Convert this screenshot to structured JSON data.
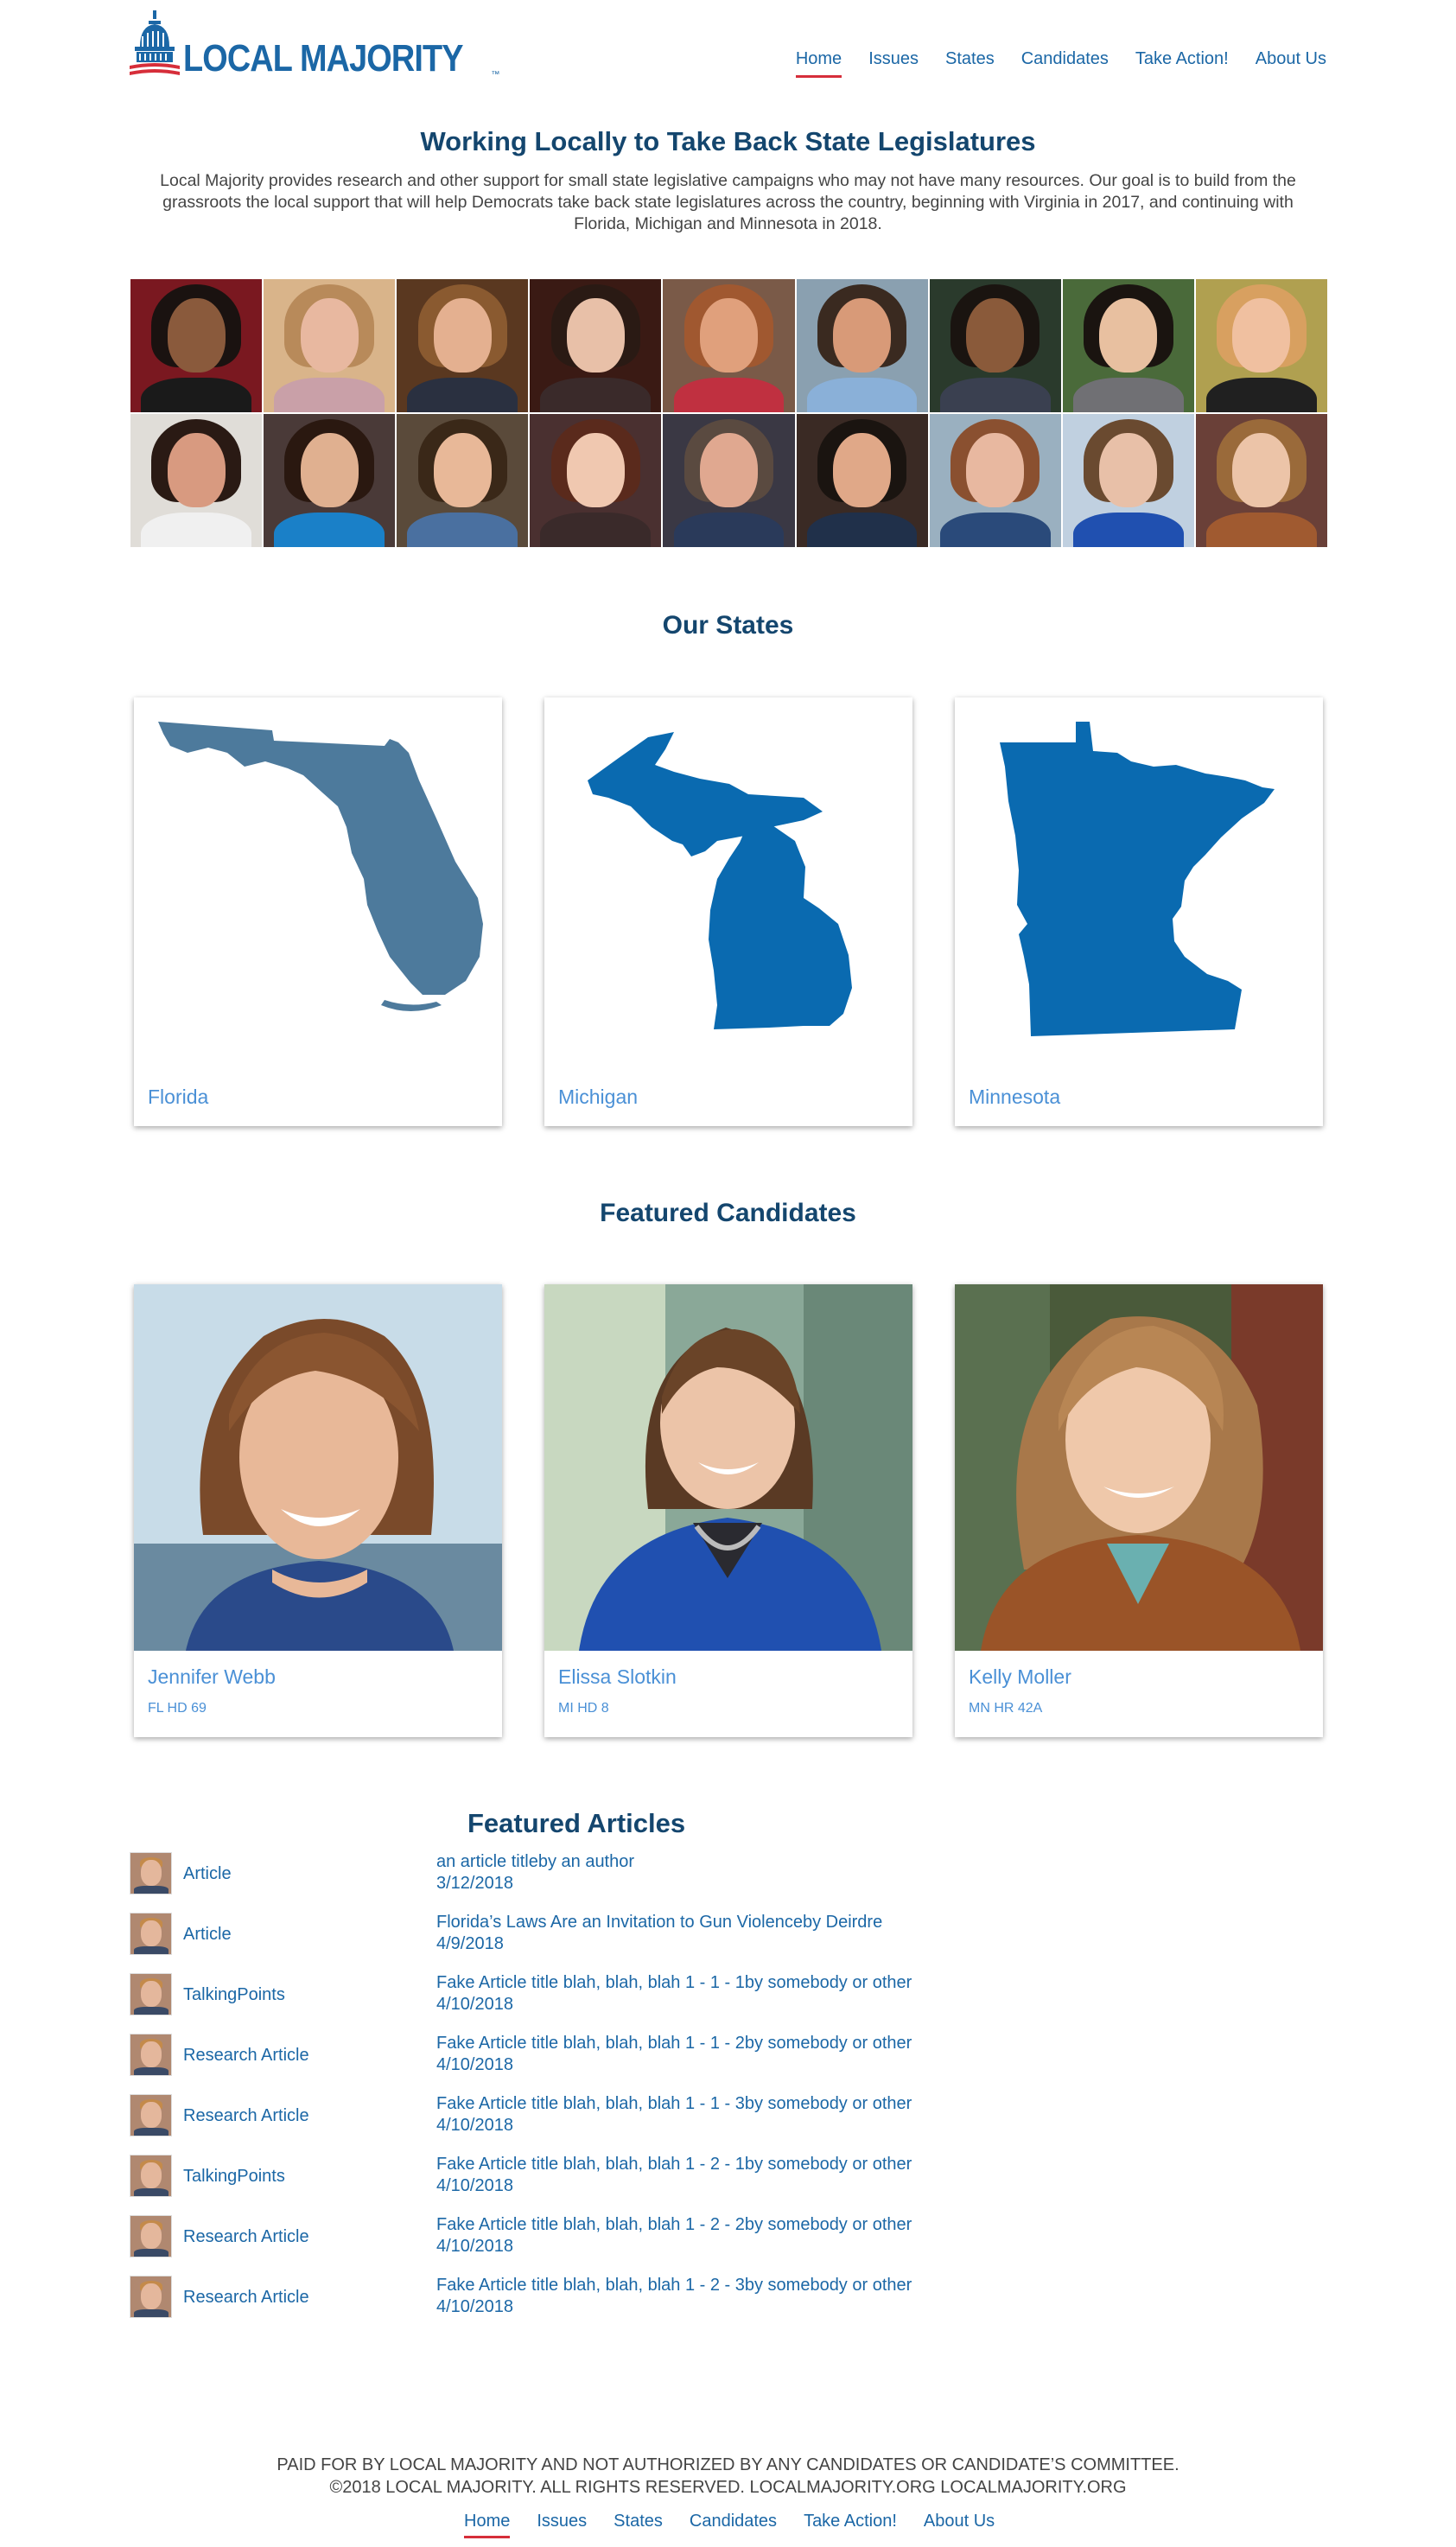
{
  "brand": {
    "name": "LOCAL MAJORITY",
    "tm": "™",
    "colors": {
      "primary": "#1b67a6",
      "heading": "#14466e",
      "accent": "#d62e3a",
      "link_light": "#4a90d6"
    }
  },
  "nav": {
    "items": [
      "Home",
      "Issues",
      "States",
      "Candidates",
      "Take Action!",
      "About Us"
    ],
    "active": "Home"
  },
  "intro": {
    "title": "Working Locally to Take Back State Legislatures",
    "text": "Local Majority provides research and other support for small state legislative campaigns who may not have many resources. Our goal is to build from the grassroots the local support that will help Democrats take back state legislatures across the country, beginning with Virginia in 2017, and continuing with Florida, Michigan and Minnesota in 2018."
  },
  "states_section": {
    "title": "Our States",
    "states": [
      {
        "name": "Florida",
        "color": "#4d7a9c"
      },
      {
        "name": "Michigan",
        "color": "#0a6ab0"
      },
      {
        "name": "Minnesota",
        "color": "#0a6ab0"
      }
    ]
  },
  "candidates_section": {
    "title": "Featured Candidates",
    "candidates": [
      {
        "name": "Jennifer Webb",
        "district": "FL HD 69"
      },
      {
        "name": "Elissa Slotkin",
        "district": "MI HD 8"
      },
      {
        "name": "Kelly Moller",
        "district": "MN HR 42A"
      }
    ]
  },
  "articles_section": {
    "title": "Featured Articles",
    "articles": [
      {
        "type": "Article",
        "title": "an article titleby an author",
        "date": "3/12/2018"
      },
      {
        "type": "Article",
        "title": "Florida’s Laws Are an Invitation to Gun Violenceby Deirdre",
        "date": "4/9/2018"
      },
      {
        "type": "TalkingPoints",
        "title": "Fake Article title blah, blah, blah 1 - 1 - 1by somebody or other",
        "date": "4/10/2018"
      },
      {
        "type": "Research Article",
        "title": "Fake Article title blah, blah, blah 1 - 1 - 2by somebody or other",
        "date": "4/10/2018"
      },
      {
        "type": "Research Article",
        "title": "Fake Article title blah, blah, blah 1 - 1 - 3by somebody or other",
        "date": "4/10/2018"
      },
      {
        "type": "TalkingPoints",
        "title": "Fake Article title blah, blah, blah 1 - 2 - 1by somebody or other",
        "date": "4/10/2018"
      },
      {
        "type": "Research Article",
        "title": "Fake Article title blah, blah, blah 1 - 2 - 2by somebody or other",
        "date": "4/10/2018"
      },
      {
        "type": "Research Article",
        "title": "Fake Article title blah, blah, blah 1 - 2 - 3by somebody or other",
        "date": "4/10/2018"
      }
    ]
  },
  "footer": {
    "line1": "PAID FOR BY LOCAL MAJORITY AND NOT AUTHORIZED BY ANY CANDIDATES OR CANDIDATE’S COMMITTEE.",
    "line2": "©2018 LOCAL MAJORITY. ALL RIGHTS RESERVED. LOCALMAJORITY.ORG LOCALMAJORITY.ORG",
    "nav": [
      "Home",
      "Issues",
      "States",
      "Candidates",
      "Take Action!",
      "About Us"
    ]
  },
  "photo_grid": {
    "tiles": [
      {
        "bg": "#7a1820",
        "skin": "#8a5a3c",
        "hair": "#1a1210",
        "shirt": "#1a1a1a"
      },
      {
        "bg": "#d9b48a",
        "skin": "#e8b8a0",
        "hair": "#b88a5a",
        "shirt": "#c9a0a8"
      },
      {
        "bg": "#5a3820",
        "skin": "#e4b090",
        "hair": "#8a5a30",
        "shirt": "#2a3040"
      },
      {
        "bg": "#3a1a14",
        "skin": "#e8c0a8",
        "hair": "#2a1a14",
        "shirt": "#3a2a2a"
      },
      {
        "bg": "#7a5a48",
        "skin": "#e0a07c",
        "hair": "#a05830",
        "shirt": "#c03040"
      },
      {
        "bg": "#8aa0b0",
        "skin": "#d89a78",
        "hair": "#3a2a20",
        "shirt": "#8ab0d8"
      },
      {
        "bg": "#2a3a2c",
        "skin": "#8a5a3a",
        "hair": "#1a1410",
        "shirt": "#3a4050"
      },
      {
        "bg": "#4a6a3a",
        "skin": "#e8c0a0",
        "hair": "#1a1410",
        "shirt": "#707074"
      },
      {
        "bg": "#b0a050",
        "skin": "#f0c0a0",
        "hair": "#d8a060",
        "shirt": "#202020"
      },
      {
        "bg": "#e0ddd8",
        "skin": "#d89a80",
        "hair": "#2a1a14",
        "shirt": "#f0f0f0"
      },
      {
        "bg": "#4a3a38",
        "skin": "#e0b090",
        "hair": "#2a1810",
        "shirt": "#1a80c8"
      },
      {
        "bg": "#5a4a3a",
        "skin": "#e8b898",
        "hair": "#3a2818",
        "shirt": "#4a70a0"
      },
      {
        "bg": "#4a3030",
        "skin": "#f0c8b0",
        "hair": "#5a2a1c",
        "shirt": "#3a2a2a"
      },
      {
        "bg": "#3a3844",
        "skin": "#e0a890",
        "hair": "#5a4a40",
        "shirt": "#2a3a5a"
      },
      {
        "bg": "#3a2a24",
        "skin": "#e0a888",
        "hair": "#1a1410",
        "shirt": "#20304a"
      },
      {
        "bg": "#9ab0c0",
        "skin": "#e8b8a0",
        "hair": "#8a5030",
        "shirt": "#2a4a7a"
      },
      {
        "bg": "#c0d0e0",
        "skin": "#e8c0a8",
        "hair": "#6a4a30",
        "shirt": "#2050b0"
      },
      {
        "bg": "#6a4038",
        "skin": "#ecc4a8",
        "hair": "#9a6a3a",
        "shirt": "#a05a30"
      }
    ]
  }
}
